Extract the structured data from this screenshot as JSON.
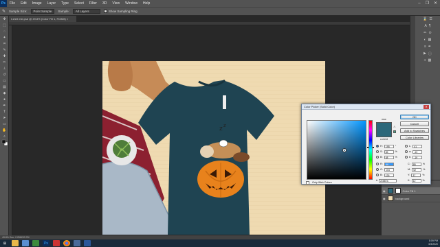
{
  "menubar": {
    "logo": "Ps",
    "items": [
      "File",
      "Edit",
      "Image",
      "Layer",
      "Type",
      "Select",
      "Filter",
      "3D",
      "View",
      "Window",
      "Help"
    ]
  },
  "options": {
    "sample_size_label": "Sample Size:",
    "sample_size_value": "Point Sample",
    "sample_label": "Sample:",
    "sample_value": "All Layers",
    "show_ring_label": "Show Sampling Ring"
  },
  "document": {
    "tab_title": "t-shirt mkt.psd @ 49.8% (Color Fill 1, RGB/8) ×",
    "status_text": "49.8%  Doc: 2.25M/93.7M"
  },
  "color_picker": {
    "title": "Color Picker (Solid Color)",
    "new_label": "new",
    "current_label": "current",
    "ok_label": "OK",
    "cancel_label": "Cancel",
    "add_to_swatches_label": "Add to Swatches",
    "color_libraries_label": "Color Libraries",
    "only_web_colors_label": "Only Web Colors",
    "hsb": {
      "H": {
        "label": "H:",
        "value": "195",
        "unit": "°"
      },
      "S": {
        "label": "S:",
        "value": "65",
        "unit": "%"
      },
      "B": {
        "label": "B:",
        "value": "48",
        "unit": "%"
      }
    },
    "rgb": {
      "R": {
        "label": "R:",
        "value": "44"
      },
      "G": {
        "label": "G:",
        "value": "104"
      },
      "B": {
        "label": "B:",
        "value": "126"
      }
    },
    "lab": {
      "L": {
        "label": "L:",
        "value": "41"
      },
      "a": {
        "label": "a:",
        "value": "-13"
      },
      "b": {
        "label": "b:",
        "value": "-19"
      }
    },
    "cmyk": {
      "C": {
        "label": "C:",
        "value": "85",
        "unit": "%"
      },
      "M": {
        "label": "M:",
        "value": "52",
        "unit": "%"
      },
      "Y": {
        "label": "Y:",
        "value": "37",
        "unit": "%"
      },
      "K": {
        "label": "K:",
        "value": "12",
        "unit": "%"
      }
    },
    "hex_label": "#",
    "hex_value": "2c687a",
    "selected_color": "#2c687a"
  },
  "layers": {
    "items": [
      {
        "name": "Color Fill 1",
        "selected": true
      },
      {
        "name": "background",
        "selected": false
      }
    ]
  },
  "taskbar": {
    "time": "8:09 PM",
    "date": "6/3/2020"
  }
}
